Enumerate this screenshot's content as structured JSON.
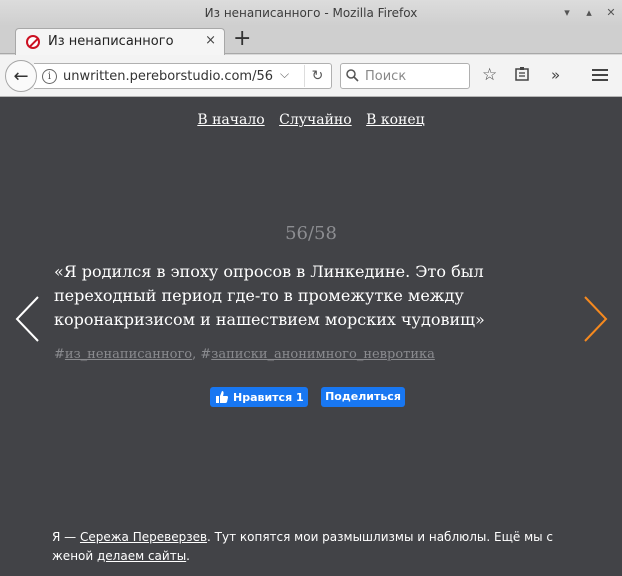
{
  "window": {
    "title": "Из ненаписанного - Mozilla Firefox"
  },
  "tab": {
    "title": "Из ненаписанного",
    "close": "×",
    "new_tab": "+"
  },
  "navbar": {
    "url": "unwritten.pereborstudio.com/56",
    "search_placeholder": "Поиск"
  },
  "page": {
    "nav": {
      "start": "В начало",
      "random": "Случайно",
      "end": "В конец"
    },
    "counter": "56/58",
    "quote": "«Я родился в эпоху опросов в Линкедине. Это был переходный период где-то в промежутке между коронакризисом и нашествием морских чудовищ»",
    "tags": [
      "из_ненаписанного",
      "записки_анонимного_невротика"
    ],
    "tag_prefix": "#",
    "tag_separator": ", ",
    "like_label": "Нравится 1",
    "share_label": "Поделиться",
    "footer": {
      "prefix": "Я — ",
      "author_link": "Сережа Переверзев",
      "middle": ". Тут копятся мои размышлизмы и наблюлы. Ещё мы с женой ",
      "sites_link": "делаем сайты",
      "suffix": "."
    }
  },
  "colors": {
    "page_bg": "#424347",
    "next_arrow": "#f5891f",
    "prev_arrow": "#ffffff",
    "fb_blue": "#1877f2"
  }
}
